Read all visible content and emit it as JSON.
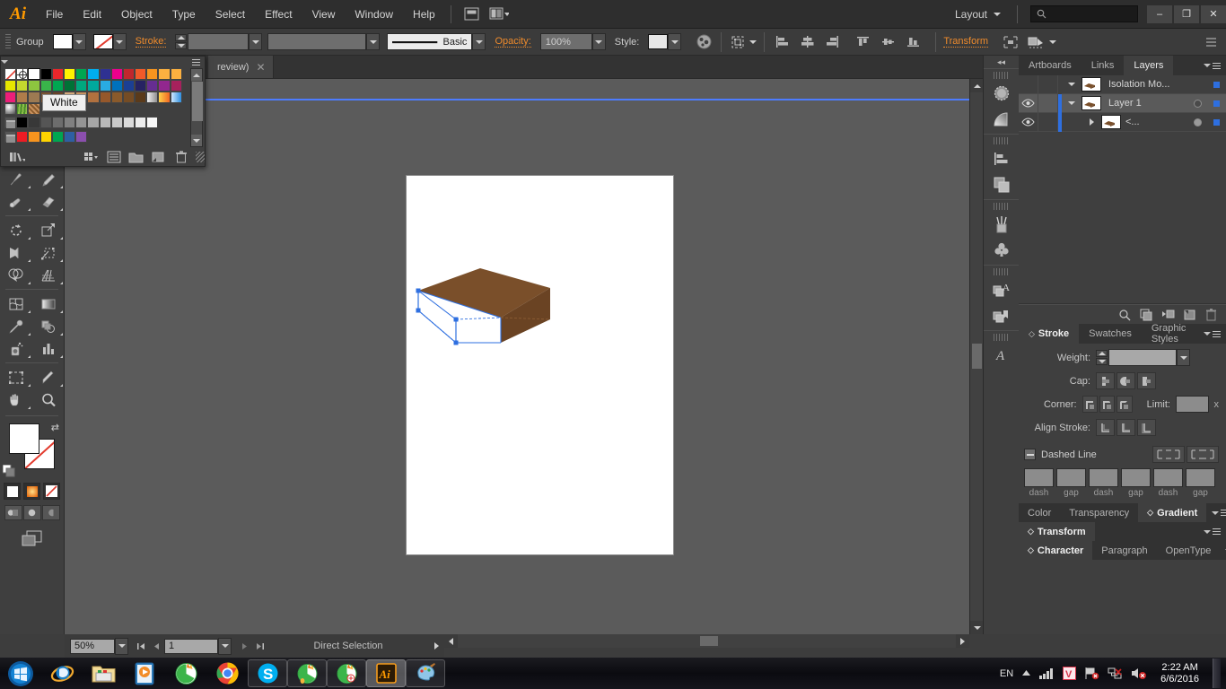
{
  "app": {
    "name": "Adobe Illustrator",
    "logo_text": "Ai"
  },
  "menubar": {
    "items": [
      "File",
      "Edit",
      "Object",
      "Type",
      "Select",
      "Effect",
      "View",
      "Window",
      "Help"
    ],
    "bridge_icon": "bridge-icon",
    "arrange_icon": "arrange-documents-icon",
    "workspace_label": "Layout",
    "search_placeholder": "",
    "window_buttons": {
      "minimize": "–",
      "restore": "❐",
      "close": "✕"
    }
  },
  "controlbar": {
    "selection_label": "Group",
    "fill_label": "fill-swatch",
    "stroke_label": "Stroke:",
    "stroke_weight": "",
    "stroke_profile": "",
    "brush_label": "Basic",
    "opacity_label": "Opacity:",
    "opacity_value": "100%",
    "style_label": "Style:",
    "recolor_icon": "recolor-artwork-icon",
    "align_icon": "align-icon",
    "transform_label": "Transform",
    "isolate_icon": "isolate-selected-object-icon",
    "draw_behind_icon": "draw-behind-icon",
    "more_icon": "more-options-icon"
  },
  "toolbar": {
    "tools": [
      {
        "name": "brush-tool",
        "row": 0,
        "col": 0
      },
      {
        "name": "pencil-tool",
        "row": 0,
        "col": 1
      },
      {
        "name": "blob-brush-tool",
        "row": 1,
        "col": 0
      },
      {
        "name": "eraser-tool",
        "row": 1,
        "col": 1
      },
      {
        "name": "rotate-tool",
        "row": 2,
        "col": 0
      },
      {
        "name": "scale-tool",
        "row": 2,
        "col": 1
      },
      {
        "name": "width-tool",
        "row": 3,
        "col": 0
      },
      {
        "name": "free-transform-tool",
        "row": 3,
        "col": 1
      },
      {
        "name": "shape-builder-tool",
        "row": 4,
        "col": 0
      },
      {
        "name": "perspective-grid-tool",
        "row": 4,
        "col": 1
      },
      {
        "name": "mesh-tool",
        "row": 5,
        "col": 0
      },
      {
        "name": "gradient-tool",
        "row": 5,
        "col": 1
      },
      {
        "name": "eyedropper-tool",
        "row": 6,
        "col": 0
      },
      {
        "name": "blend-tool",
        "row": 6,
        "col": 1
      },
      {
        "name": "symbol-sprayer-tool",
        "row": 7,
        "col": 0
      },
      {
        "name": "column-graph-tool",
        "row": 7,
        "col": 1
      },
      {
        "name": "artboard-tool",
        "row": 8,
        "col": 0
      },
      {
        "name": "slice-tool",
        "row": 8,
        "col": 1
      },
      {
        "name": "hand-tool",
        "row": 9,
        "col": 0
      },
      {
        "name": "zoom-tool",
        "row": 9,
        "col": 1
      }
    ],
    "fill_color": "#ffffff",
    "stroke_color": "none",
    "color_mode_buttons": [
      "color-button",
      "gradient-button",
      "none-button"
    ],
    "draw_mode_buttons": [
      "draw-normal",
      "draw-behind",
      "draw-inside"
    ],
    "screen_mode": "change-screen-mode-icon"
  },
  "swatches_panel": {
    "title": "Swatches",
    "tooltip": "White",
    "row1": [
      "none",
      "registration",
      "#ffffff",
      "#000000",
      "#e8262b",
      "#fff200",
      "#00a651",
      "#00aeef",
      "#2e3192",
      "#ec008c",
      "#c1272d",
      "#f15a29",
      "#f7941e",
      "#fbb040"
    ],
    "row2": [
      "#fbb040",
      "#e6e600",
      "#c4d82e",
      "#8dc63f",
      "#39b54a",
      "#00a651",
      "#007236",
      "#00a87e",
      "#00a99d",
      "#29abe2",
      "#0071bc",
      "#1b3f94",
      "#262262",
      "#662d91"
    ],
    "row3": [
      "#92278f",
      "#a6215c",
      "#ed1e79",
      "#b07c4a",
      "#9d7a52",
      "#7a5230",
      "#6b4226",
      "#d2a679",
      "#c8915e",
      "#b1713f",
      "#96582b",
      "#8a5a2b",
      "#754c24",
      "#5a3a1a"
    ],
    "row4": [
      "gradient-white",
      "gradient-orange",
      "gradient-blue",
      "pattern-sphere",
      "pattern-grass",
      "pattern-texture"
    ],
    "grays": [
      "folder",
      "#000000",
      "#383838",
      "#555555",
      "#6d6d6d",
      "#808080",
      "#949494",
      "#a6a6a6",
      "#b8b8b8",
      "#c9c9c9",
      "#dadada",
      "#ececec",
      "#f7f7f7"
    ],
    "brights": [
      "folder",
      "#ed1c24",
      "#f7941e",
      "#ffd400",
      "#00a651",
      "#2e5fa3",
      "#8b4fae"
    ],
    "footer_buttons": [
      "swatch-libraries-menu",
      "show-swatch-kinds-menu",
      "swatch-options",
      "new-color-group",
      "new-swatch",
      "delete-swatch"
    ]
  },
  "document": {
    "tab_label": "review)",
    "close_label": "✕",
    "zoom": "50%",
    "page_number": "1",
    "current_tool_status": "Direct Selection"
  },
  "icon_dock": {
    "collapse_label": "◂◂",
    "groups": [
      [
        "brushes-icon",
        "gradient-panel-icon"
      ],
      [
        "align-panel-icon",
        "pathfinder-panel-icon"
      ],
      [
        "brush-libraries-icon",
        "symbols-panel-icon"
      ],
      [
        "appearance-icon",
        "graphic-styles-icon"
      ],
      [
        "character-panel-icon"
      ]
    ]
  },
  "layers_panel": {
    "tabs": [
      "Artboards",
      "Links",
      "Layers"
    ],
    "active_tab": "Layers",
    "rows": [
      {
        "name": "Isolation Mo...",
        "visible": false,
        "selected": false,
        "expanded": true,
        "indent": 0,
        "has_target": false
      },
      {
        "name": "Layer 1",
        "visible": true,
        "selected": true,
        "expanded": true,
        "indent": 1,
        "has_target": true
      },
      {
        "name": "<...",
        "visible": true,
        "selected": false,
        "expanded": false,
        "indent": 2,
        "has_target": true
      }
    ],
    "footer_buttons": [
      "locate-object",
      "make-clipping-mask",
      "create-new-sublayer",
      "create-new-layer",
      "delete-selection"
    ]
  },
  "stroke_panel": {
    "tabs": [
      "Stroke",
      "Swatches",
      "Graphic Styles"
    ],
    "active_tab": "Stroke",
    "weight_label": "Weight:",
    "weight_value": "",
    "cap_label": "Cap:",
    "corner_label": "Corner:",
    "limit_label": "Limit:",
    "limit_value": "",
    "limit_unit": "x",
    "align_stroke_label": "Align Stroke:",
    "dashed_line_label": "Dashed Line",
    "dash_fields": [
      "dash",
      "gap",
      "dash",
      "gap",
      "dash",
      "gap"
    ]
  },
  "bottom_panels": {
    "group1": {
      "tabs": [
        "Color",
        "Transparency",
        "Gradient"
      ],
      "active": "Gradient"
    },
    "group2": {
      "tabs": [
        "Transform"
      ],
      "active": "Transform"
    },
    "group3": {
      "tabs": [
        "Character",
        "Paragraph",
        "OpenType"
      ],
      "active": "Character"
    }
  },
  "artwork": {
    "description": "3d-brown-box",
    "top_face_color": "#7a4f2a",
    "side_face_color": "#6e4624",
    "front_face_color": "#ffffff",
    "selection_color": "#2e6fe0"
  },
  "taskbar": {
    "start": "windows-start-orb",
    "pinned": [
      "internet-explorer-icon",
      "windows-explorer-icon",
      "media-player-icon",
      "green-app-icon",
      "google-chrome-icon"
    ],
    "running": [
      "skype-icon",
      "green-app-window-icon",
      "green-app-window-2-icon",
      "adobe-illustrator-icon",
      "paint-icon"
    ],
    "active_app": "adobe-illustrator-icon",
    "tray": {
      "language": "EN",
      "icons": [
        "show-hidden-icons-arrow",
        "network-signal-icon",
        "v-antivirus-icon",
        "flag-action-center-icon",
        "network-error-icon",
        "volume-muted-icon"
      ],
      "time": "2:22 AM",
      "date": "6/6/2016"
    }
  },
  "colors": {
    "accent_orange": "#ef8b2c",
    "panel_bg": "#3f3f3f",
    "menubar_bg": "#2e2e2e",
    "canvas_bg": "#5b5b5b",
    "selection_blue": "#2e6fe0"
  }
}
